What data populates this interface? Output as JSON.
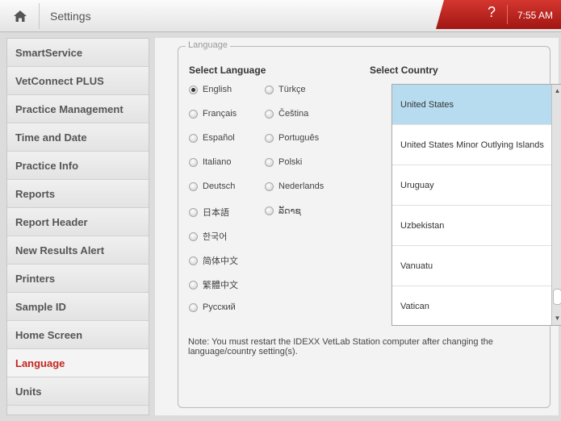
{
  "header": {
    "title": "Settings",
    "help_symbol": "?",
    "time": "7:55 AM"
  },
  "sidebar": {
    "items": [
      {
        "label": "SmartService",
        "active": false
      },
      {
        "label": "VetConnect PLUS",
        "active": false
      },
      {
        "label": "Practice Management",
        "active": false
      },
      {
        "label": "Time and Date",
        "active": false
      },
      {
        "label": "Practice Info",
        "active": false
      },
      {
        "label": "Reports",
        "active": false
      },
      {
        "label": "Report Header",
        "active": false
      },
      {
        "label": "New Results Alert",
        "active": false
      },
      {
        "label": "Printers",
        "active": false
      },
      {
        "label": "Sample ID",
        "active": false
      },
      {
        "label": "Home Screen",
        "active": false
      },
      {
        "label": "Language",
        "active": true
      },
      {
        "label": "Units",
        "active": false
      }
    ]
  },
  "language_panel": {
    "legend": "Language",
    "select_language_label": "Select Language",
    "select_country_label": "Select Country",
    "languages_left": [
      "English",
      "Français",
      "Español",
      "Italiano",
      "Deutsch",
      "日本語",
      "한국어",
      "简体中文",
      "繁體中文",
      "Русский"
    ],
    "languages_right": [
      "Türkçe",
      "Čeština",
      "Português",
      "Polski",
      "Nederlands",
      "ລັດາຊ"
    ],
    "selected_language": "English",
    "countries": [
      "United States",
      "United States Minor Outlying Islands",
      "Uruguay",
      "Uzbekistan",
      "Vanuatu",
      "Vatican"
    ],
    "selected_country": "United States",
    "note": "Note: You must restart the IDEXX VetLab Station computer after changing the language/country setting(s).",
    "scroll_up_icon": "chevron-up-icon",
    "scroll_down_icon": "chevron-down-icon"
  },
  "colors": {
    "accent": "#c3271f",
    "selected_row": "#b7dcef"
  }
}
